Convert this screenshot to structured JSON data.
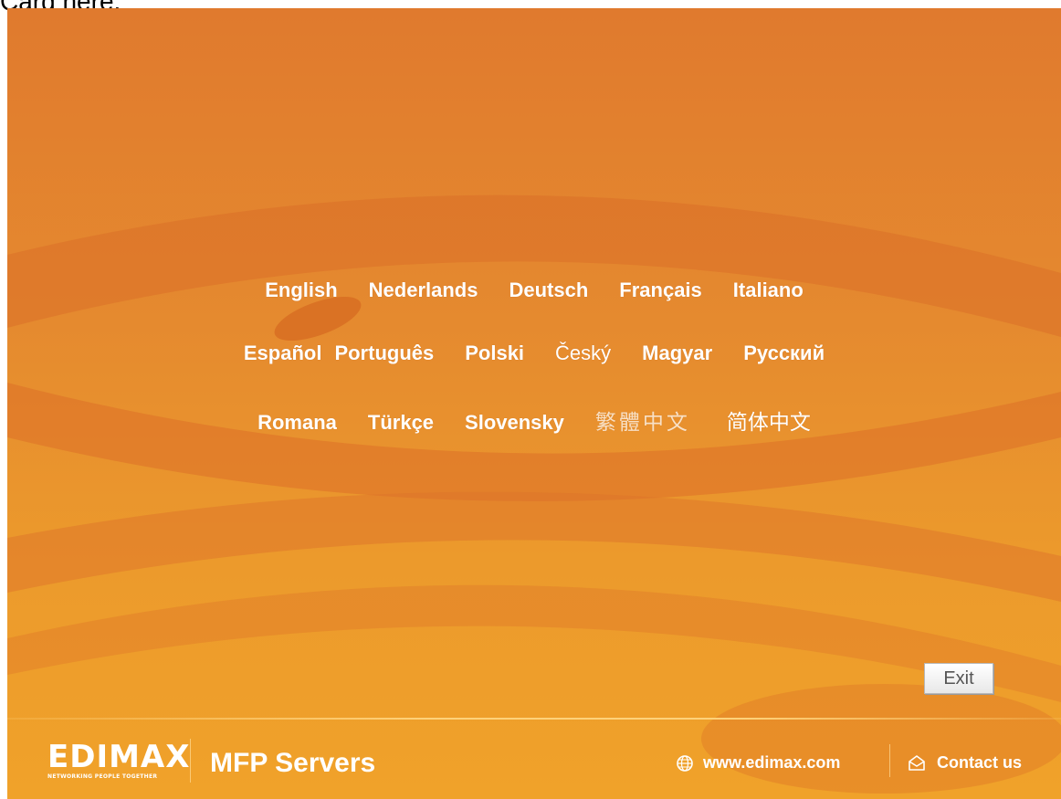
{
  "top_caption": "Card here.",
  "languages": {
    "row1": [
      "English",
      "Nederlands",
      "Deutsch",
      "Français",
      "Italiano"
    ],
    "row2": [
      "Español",
      "Português",
      "Polski",
      "Český",
      "Magyar",
      "Русский"
    ],
    "row3": [
      "Romana",
      "Türkçe",
      "Slovensky",
      "繁體中文",
      "简体中文"
    ]
  },
  "exit_label": "Exit",
  "footer": {
    "brand": "EDIMAX",
    "tagline": "NETWORKING PEOPLE TOGETHER",
    "product": "MFP Servers",
    "website_label": "www.edimax.com",
    "contact_label": "Contact us",
    "website_icon": "globe-icon",
    "contact_icon": "envelope-icon"
  },
  "colors": {
    "background_top": "#e07a2e",
    "background_bottom": "#f0a22a",
    "text": "#ffffff"
  }
}
